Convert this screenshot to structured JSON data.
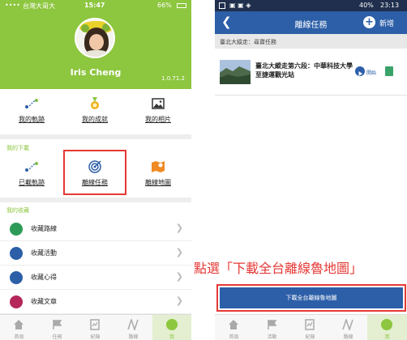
{
  "left_phone": {
    "status_bar": {
      "carrier": "台灣大哥大",
      "time": "15:47",
      "battery": "66%"
    },
    "profile": {
      "name": "Iris Cheng",
      "version": "1.0.71.2"
    },
    "top_menu": [
      {
        "label": "我的軌跡",
        "icon": "route-icon"
      },
      {
        "label": "我的成就",
        "icon": "medal-icon"
      },
      {
        "label": "我的相片",
        "icon": "photo-icon"
      }
    ],
    "downloads": {
      "title": "我的下載",
      "items": [
        {
          "label": "已載軌跡",
          "icon": "route-icon"
        },
        {
          "label": "離線任務",
          "icon": "target-icon"
        },
        {
          "label": "離線地圖",
          "icon": "map-icon"
        }
      ]
    },
    "favorites": {
      "title": "我的收藏",
      "items": [
        {
          "label": "收藏路線",
          "icon": "signpost-icon",
          "color": "#2e9a58"
        },
        {
          "label": "收藏活動",
          "icon": "hiker-icon",
          "color": "#2d5fa8"
        },
        {
          "label": "收藏心得",
          "icon": "notes-icon",
          "color": "#2d5fa8"
        },
        {
          "label": "收藏文章",
          "icon": "article-icon",
          "color": "#b5265a"
        }
      ]
    },
    "tabs": [
      {
        "label": "首頁",
        "icon": "home-icon"
      },
      {
        "label": "任務",
        "icon": "flag-icon"
      },
      {
        "label": "紀錄",
        "icon": "record-icon"
      },
      {
        "label": "路線",
        "icon": "route-icon"
      },
      {
        "label": "我",
        "icon": "me-icon",
        "active": true
      }
    ]
  },
  "right_phone": {
    "status_bar": {
      "battery": "40%",
      "time": "23:13"
    },
    "header": {
      "title": "離線任務",
      "add_label": "新增"
    },
    "breadcrumb": "臺北大縱走：尋寶任務",
    "task": {
      "title": "臺北大縱走第六段：中華科技大學至捷運觀光站",
      "start_label": "開始"
    },
    "download_all_label": "下載全台離線魯地圖",
    "tabs": [
      {
        "label": "首頁",
        "icon": "home-icon"
      },
      {
        "label": "活動",
        "icon": "flag-icon"
      },
      {
        "label": "紀錄",
        "icon": "record-icon"
      },
      {
        "label": "路線",
        "icon": "route-icon"
      },
      {
        "label": "我",
        "icon": "me-icon",
        "active": true
      }
    ]
  },
  "annotation": "點選「下載全台離線魯地圖」",
  "colors": {
    "green": "#8dc63f",
    "blue": "#2d5fa8",
    "red": "#e53935"
  }
}
